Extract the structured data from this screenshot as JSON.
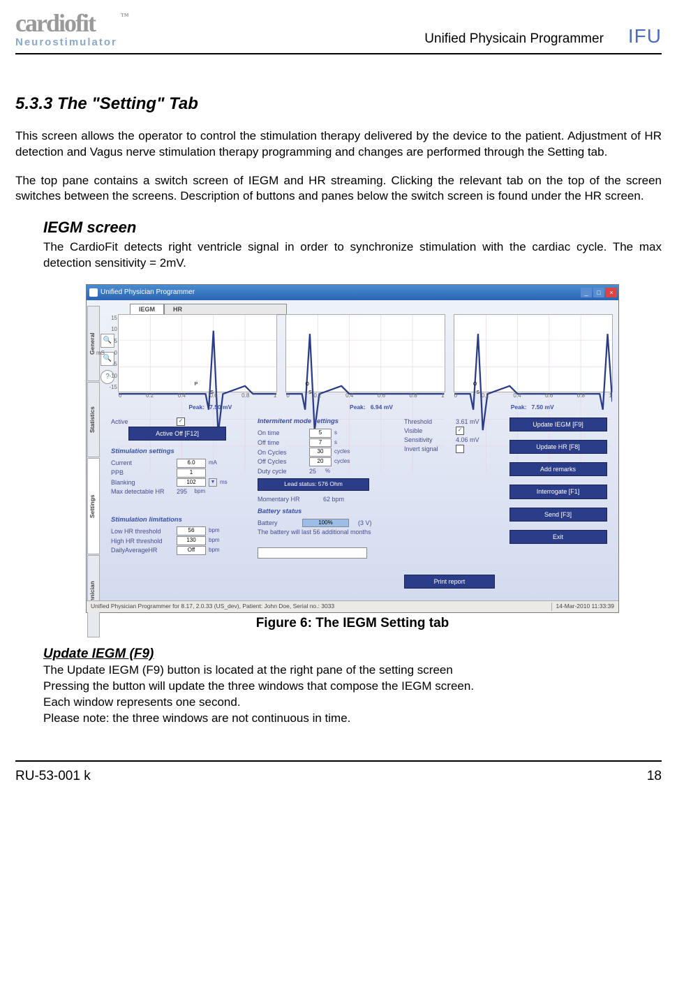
{
  "header": {
    "logo_main": "cardiofit",
    "logo_sub": "Neurostimulator",
    "doc_name": "Unified Physicain Programmer",
    "ifu": "IFU",
    "tm": "™"
  },
  "section": {
    "title": "5.3.3 The \"Setting\" Tab",
    "p1": "This screen allows the operator to control the stimulation therapy delivered by the device to the patient. Adjustment of HR detection and Vagus nerve stimulation therapy programming and changes are performed through the Setting tab.",
    "p2": "The top pane contains a switch screen of IEGM and HR streaming. Clicking the relevant tab on the top of the screen switches between the screens. Description of buttons and panes below the switch screen is found under the HR screen.",
    "sub1_title": "IEGM screen",
    "sub1_text": "The CardioFit detects right ventricle signal in order to synchronize stimulation with the cardiac cycle. The max detection sensitivity = 2mV.",
    "caption": "Figure 6: The IEGM Setting tab",
    "sub2_title": "Update IEGM (F9)",
    "sub2_l1": "The Update IEGM (F9) button is located at the right pane of the setting screen",
    "sub2_l2": "Pressing the button will update the three windows that compose the IEGM screen.",
    "sub2_l3": "Each window represents one second.",
    "sub2_l4": "Please note: the three windows are not continuous in time."
  },
  "figure": {
    "window_title": "Unified Physician Programmer",
    "side_tabs": [
      "General",
      "Statistics",
      "Settings",
      "Technician"
    ],
    "top_tabs": {
      "iegm": "IEGM",
      "hr": "HR"
    },
    "plot": {
      "y_ticks": [
        "15",
        "10",
        "5",
        "0",
        "-5",
        "-10",
        "-15"
      ],
      "ylabel": "mS",
      "x_ticks": [
        "0",
        "0.2",
        "0.4",
        "0.6",
        "0.8",
        "1"
      ],
      "marker_p": "P",
      "marker_o": "O",
      "marker_s": "S"
    },
    "peaks": {
      "label": "Peak:",
      "v1": "7.50 mV",
      "v2": "6.94 mV",
      "v3": "7.50 mV"
    },
    "col1": {
      "active_lbl": "Active",
      "active_off_btn": "Active Off  [F12]",
      "stim_title": "Stimulation settings",
      "current_lbl": "Current",
      "current_val": "6.0",
      "current_unit": "mA",
      "ppb_lbl": "PPB",
      "ppb_val": "1",
      "blank_lbl": "Blanking",
      "blank_val": "102",
      "blank_unit": "ms",
      "maxhr_lbl": "Max detectable HR",
      "maxhr_val": "295",
      "maxhr_unit": "bpm",
      "lim_title": "Stimulation limitations",
      "low_lbl": "Low HR threshold",
      "low_val": "56",
      "low_unit": "bpm",
      "high_lbl": "High HR threshold",
      "high_val": "130",
      "high_unit": "bpm",
      "avg_lbl": "DailyAverageHR",
      "avg_val": "Off",
      "avg_unit": "bpm"
    },
    "col2": {
      "int_title": "Intermitent mode settings",
      "on_lbl": "On time",
      "on_val": "5",
      "on_unit": "s",
      "off_lbl": "Off time",
      "off_val": "7",
      "off_unit": "s",
      "onc_lbl": "On Cycles",
      "onc_val": "30",
      "onc_unit": "cycles",
      "offc_lbl": "Off Cycles",
      "offc_val": "20",
      "offc_unit": "cycles",
      "duty_lbl": "Duty cycle",
      "duty_val": "25",
      "duty_unit": "%",
      "lead_btn": "Lead status:  576 Ohm",
      "mhr_lbl": "Momentary HR",
      "mhr_val": "62 bpm",
      "bat_title": "Battery status",
      "bat_lbl": "Battery",
      "bat_pct": "100%",
      "bat_v": "(3 V)",
      "bat_life": "The battery will last 56    additional months"
    },
    "col3": {
      "th_lbl": "Threshold",
      "th_val": "3.61 mV",
      "vis_lbl": "Visible",
      "sens_lbl": "Sensitivity",
      "sens_val": "4.06 mV",
      "inv_lbl": "Invert signal",
      "print_btn": "Print report"
    },
    "col4": {
      "update_iegm": "Update IEGM [F9]",
      "update_hr": "Update HR [F8]",
      "add_remarks": "Add remarks",
      "interrogate": "Interrogate  [F1]",
      "send": "Send  [F3]",
      "exit": "Exit"
    },
    "statusbar": {
      "left": "Unified Physician Programmer for 8.17,  2.0.33  (US_dev),  Patient: John Doe, Serial no.: 3033",
      "right": "14-Mar-2010 11:33:39"
    }
  },
  "footer": {
    "left": "RU-53-001 k",
    "right": "18"
  }
}
